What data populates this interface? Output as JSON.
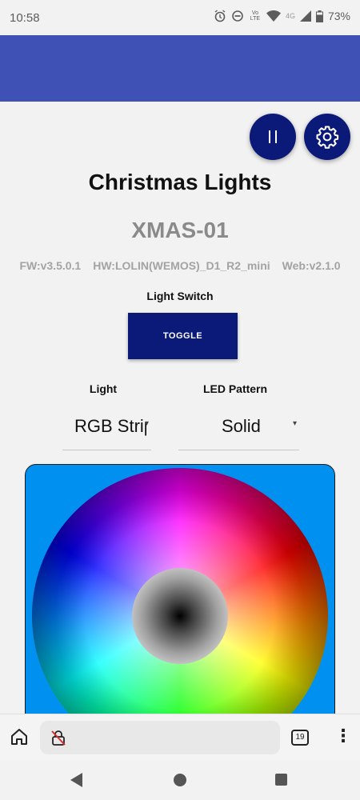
{
  "status_bar": {
    "time": "10:58",
    "battery": "73%",
    "network": "4G",
    "volte": "Vo LTE"
  },
  "app": {
    "title": "Christmas Lights",
    "device_name": "XMAS-01",
    "firmware": "FW:v3.5.0.1",
    "hardware": "HW:LOLIN(WEMOS)_D1_R2_mini",
    "web_version": "Web:v2.1.0"
  },
  "light_switch": {
    "label": "Light Switch",
    "button_label": "TOGGLE"
  },
  "light_select": {
    "label": "Light",
    "value": "RGB Strip"
  },
  "pattern_select": {
    "label": "LED Pattern",
    "value": "Solid"
  },
  "browser": {
    "tab_count": "19"
  },
  "colors": {
    "app_bar": "#3f51b5",
    "primary_dark": "#0b1a78",
    "picker_background": "#0090f0"
  },
  "icons": {
    "pause_fab": "pause-icon",
    "settings_fab": "gear-icon",
    "home": "home-icon",
    "url": "insecure-lock-icon",
    "menu": "vertical-dots-icon"
  }
}
